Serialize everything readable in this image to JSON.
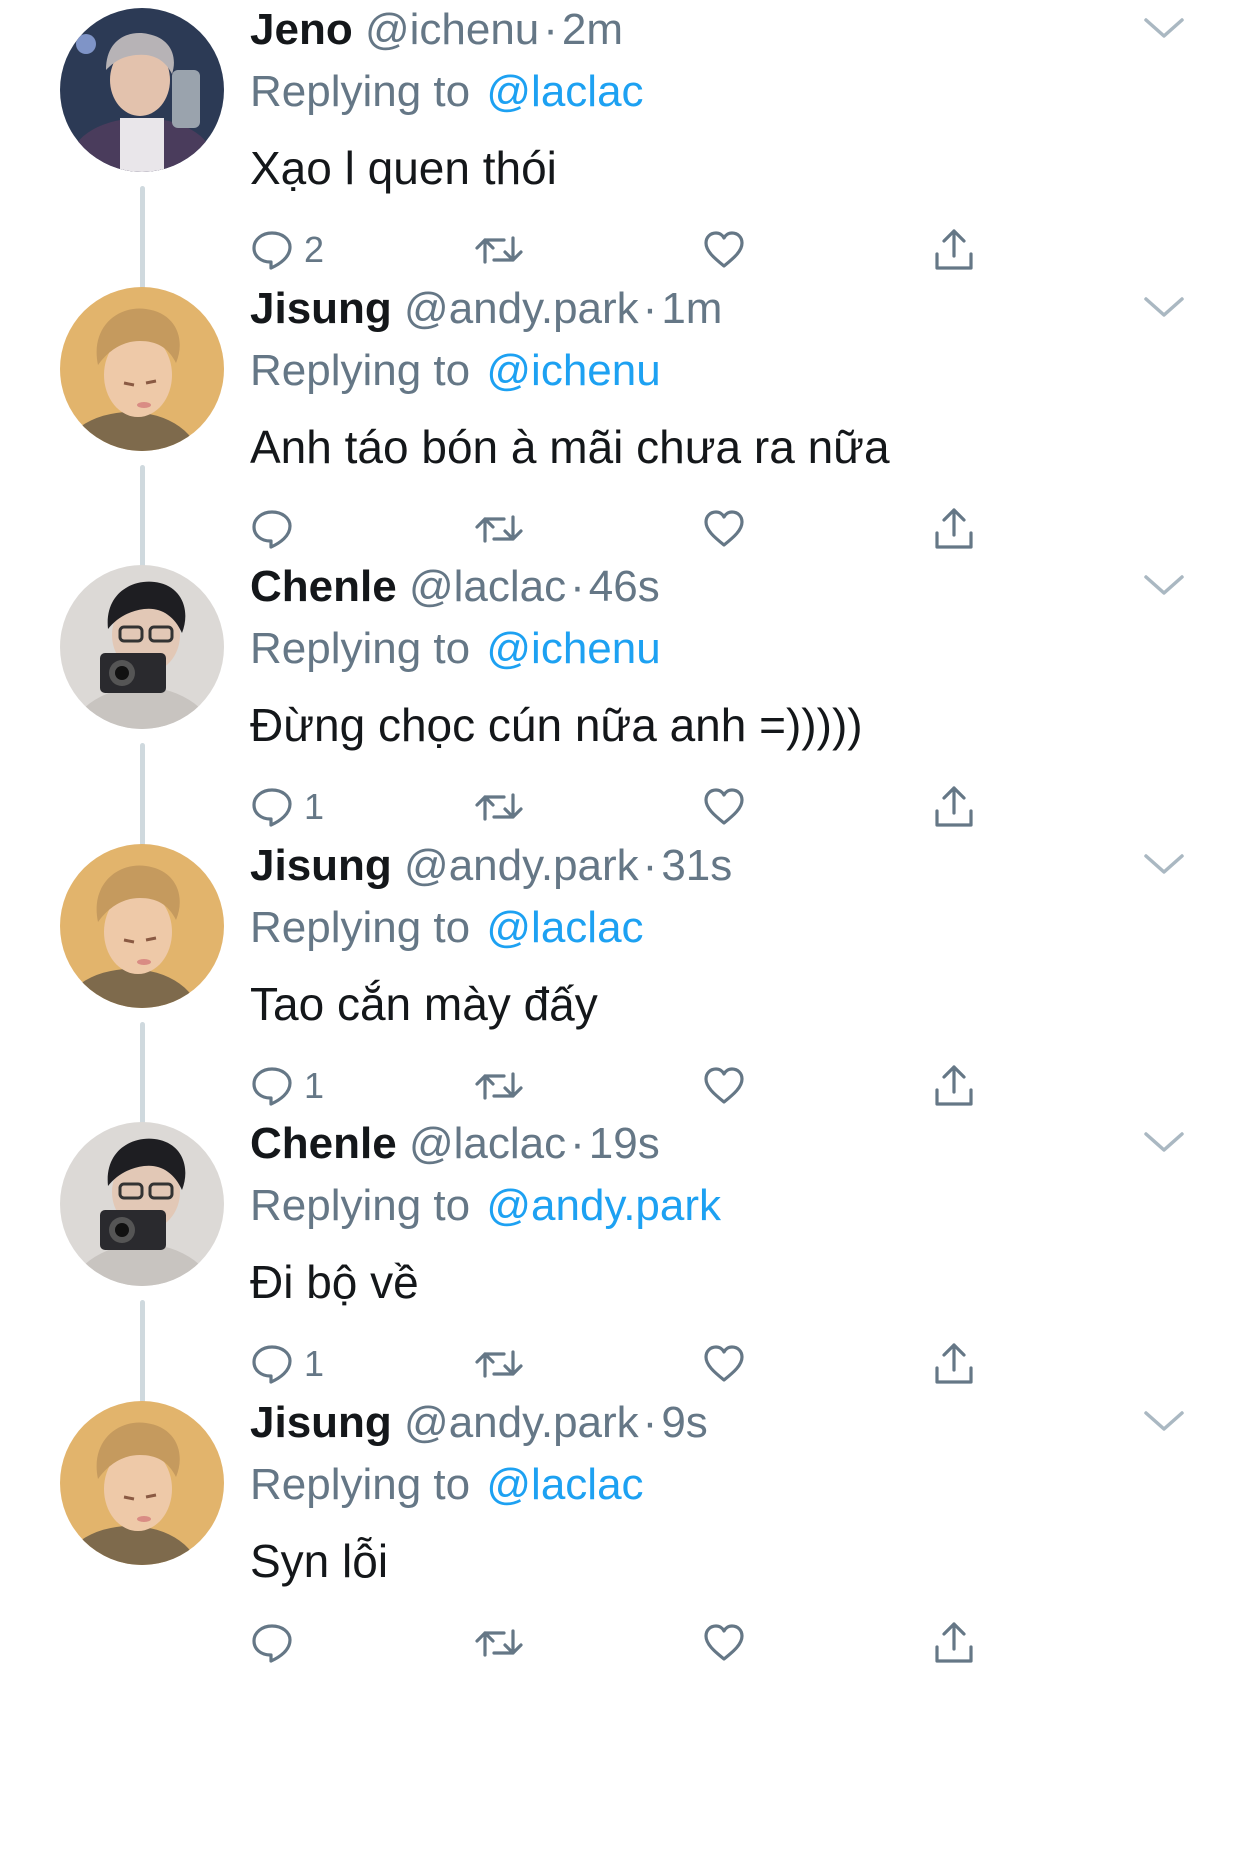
{
  "tweets": [
    {
      "name": "Jeno",
      "handle": "@ichenu",
      "sep": "·",
      "time": "2m",
      "replying_label": "Replying to",
      "replying_to": "@laclac",
      "text": "Xạo l quen thói",
      "reply_count": "2",
      "avatar": "jeno",
      "has_thread_line": true
    },
    {
      "name": "Jisung",
      "handle": "@andy.park",
      "sep": "·",
      "time": "1m",
      "replying_label": "Replying to",
      "replying_to": "@ichenu",
      "text": "Anh táo bón à mãi chưa ra nữa",
      "reply_count": "",
      "avatar": "jisung",
      "has_thread_line": true
    },
    {
      "name": "Chenle",
      "handle": "@laclac",
      "sep": "·",
      "time": "46s",
      "replying_label": "Replying to",
      "replying_to": "@ichenu",
      "text": "Đừng chọc cún nữa anh =)))))",
      "reply_count": "1",
      "avatar": "chenle",
      "has_thread_line": true
    },
    {
      "name": "Jisung",
      "handle": "@andy.park",
      "sep": "·",
      "time": "31s",
      "replying_label": "Replying to",
      "replying_to": "@laclac",
      "text": "Tao cắn mày đấy",
      "reply_count": "1",
      "avatar": "jisung",
      "has_thread_line": true
    },
    {
      "name": "Chenle",
      "handle": "@laclac",
      "sep": "·",
      "time": "19s",
      "replying_label": "Replying to",
      "replying_to": "@andy.park",
      "text": "Đi bộ về",
      "reply_count": "1",
      "avatar": "chenle",
      "has_thread_line": true
    },
    {
      "name": "Jisung",
      "handle": "@andy.park",
      "sep": "·",
      "time": "9s",
      "replying_label": "Replying to",
      "replying_to": "@laclac",
      "text": "Syn lỗi",
      "reply_count": "",
      "avatar": "jisung",
      "has_thread_line": false
    }
  ],
  "icons": {
    "reply": "reply-bubble-icon",
    "retweet": "retweet-icon",
    "like": "heart-icon",
    "share": "share-icon",
    "more": "chevron-down-icon"
  },
  "colors": {
    "text": "#14171a",
    "secondary": "#657786",
    "link": "#1da1f2",
    "thread_line": "#cfd9de"
  }
}
